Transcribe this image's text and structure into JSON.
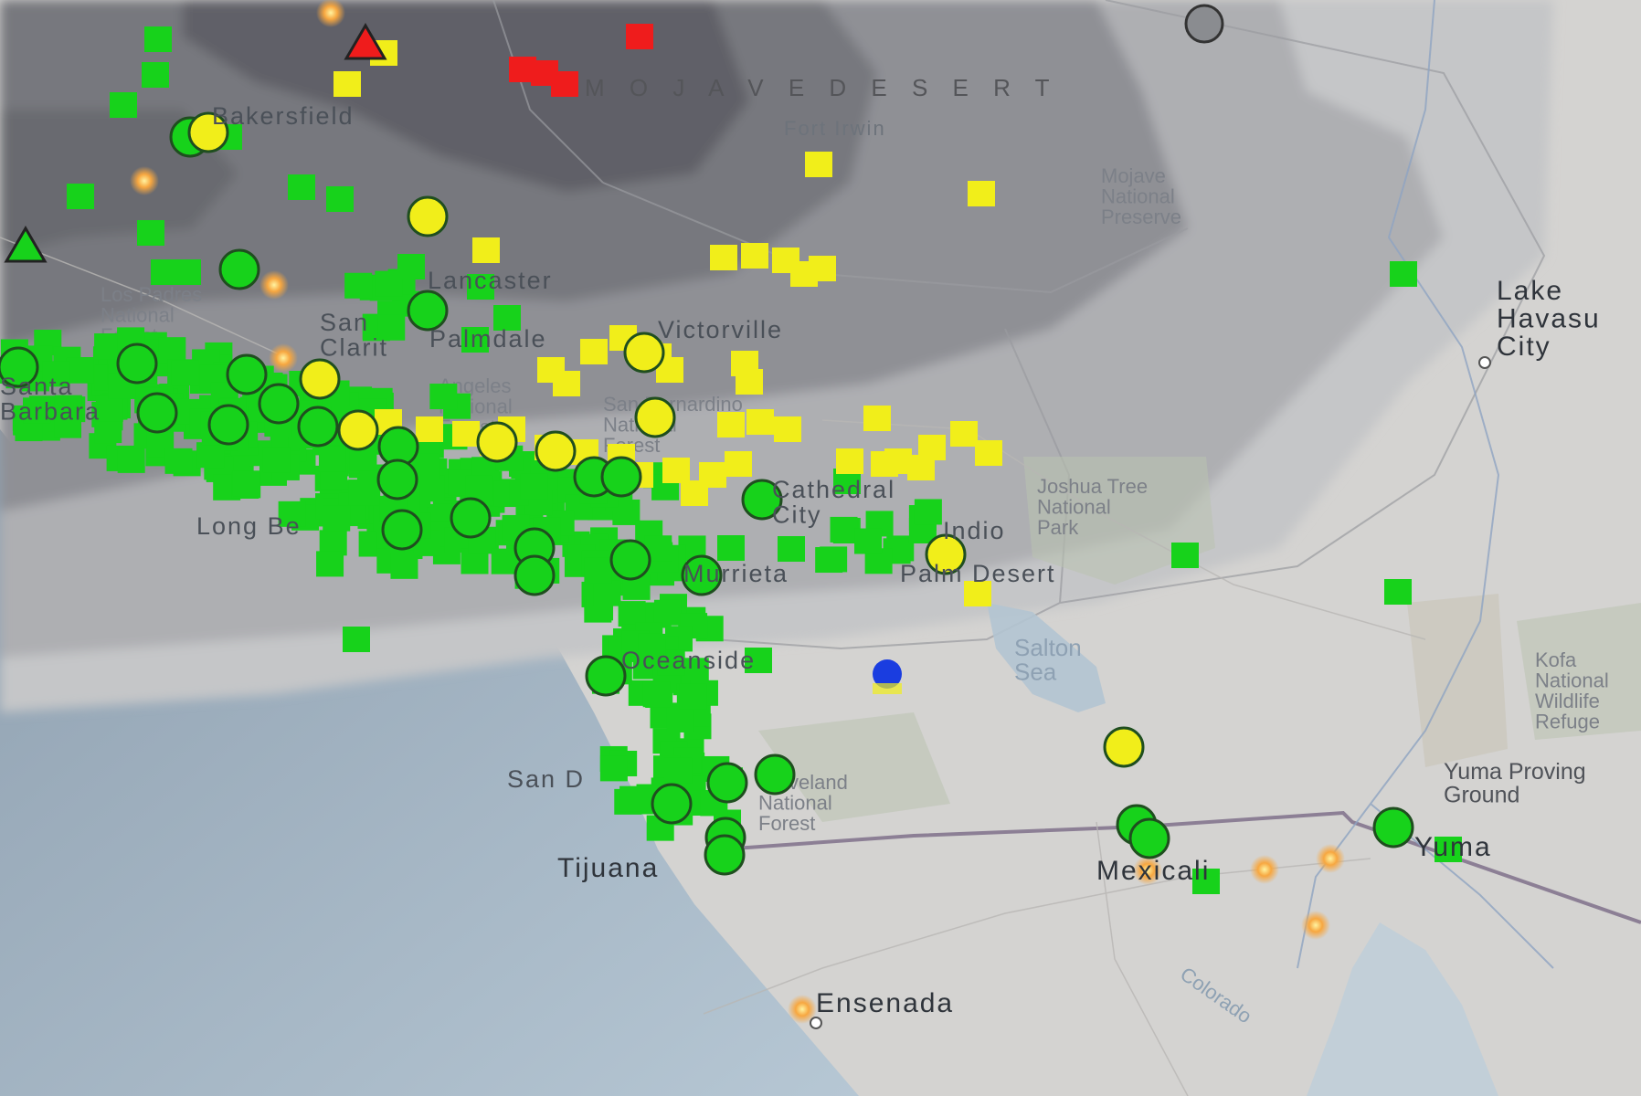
{
  "map": {
    "colors": {
      "ocean": "#a9bccb",
      "land": "#d7d5d2",
      "desert_shade_dark": "#5f6167",
      "desert_shade_mid": "#7d7f85",
      "desert_shade_light": "#a4a6aa",
      "park": "#c8cfbe",
      "border": "#8c7f95",
      "river": "#8fa4c2",
      "green_marker": "#17d21b",
      "yellow_marker": "#f1ee1a",
      "red_marker": "#ef1c1c",
      "blue_marker": "#1a3de0",
      "gray_marker": "#8a8c90",
      "orange_fire": "#f7a740"
    },
    "place_labels": [
      {
        "id": "bakersfield",
        "text": "Bakersfield"
      },
      {
        "id": "lancaster",
        "text": "Lancaster"
      },
      {
        "id": "palmdale",
        "text": "Palmdale"
      },
      {
        "id": "victorville",
        "text": "Victorville"
      },
      {
        "id": "santa-clarita",
        "text": "San\nClarit"
      },
      {
        "id": "santa-barbara",
        "text": "Santa\nBarbara"
      },
      {
        "id": "long-beach",
        "text": "Long Be"
      },
      {
        "id": "murrieta",
        "text": "Murrieta"
      },
      {
        "id": "indio",
        "text": "Indio"
      },
      {
        "id": "palm-desert",
        "text": "Palm Desert"
      },
      {
        "id": "oceanside",
        "text": "Oceanside"
      },
      {
        "id": "san-diego",
        "text": "San D"
      },
      {
        "id": "tijuana",
        "text": "Tijuana"
      },
      {
        "id": "mexicali",
        "text": "Mexicali"
      },
      {
        "id": "yuma",
        "text": "Yuma"
      },
      {
        "id": "ensenada",
        "text": "Ensenada"
      },
      {
        "id": "lake-havasu-city",
        "text": "Lake\nHavasu\nCity"
      },
      {
        "id": "fort-irwin",
        "text": "Fort Irwin"
      },
      {
        "id": "cathedral-city",
        "text": "Cathedral\nCity"
      }
    ],
    "region_labels": [
      {
        "id": "mojave-desert",
        "text": "M O J A V E   D E S E R T"
      },
      {
        "id": "mojave-preserve",
        "text": "Mojave\nNational\nPreserve"
      },
      {
        "id": "joshua-tree",
        "text": "Joshua Tree\nNational\nPark"
      },
      {
        "id": "salton-sea",
        "text": "Salton\nSea"
      },
      {
        "id": "kofa",
        "text": "Kofa\nNational\nWildlife\nRefuge"
      },
      {
        "id": "yuma-proving",
        "text": "Yuma Proving\nGround"
      },
      {
        "id": "cleveland-nf",
        "text": "Cleveland\nNational\nForest"
      },
      {
        "id": "angeles-nf",
        "text": "Angeles\nNational\nForest"
      },
      {
        "id": "los-padres-nf",
        "text": "Los Padres\nNational\nForest"
      },
      {
        "id": "san-bernardino-nf",
        "text": "San Bernardino\nNational\nForest"
      },
      {
        "id": "colorado-river",
        "text": "Colorado"
      }
    ]
  }
}
